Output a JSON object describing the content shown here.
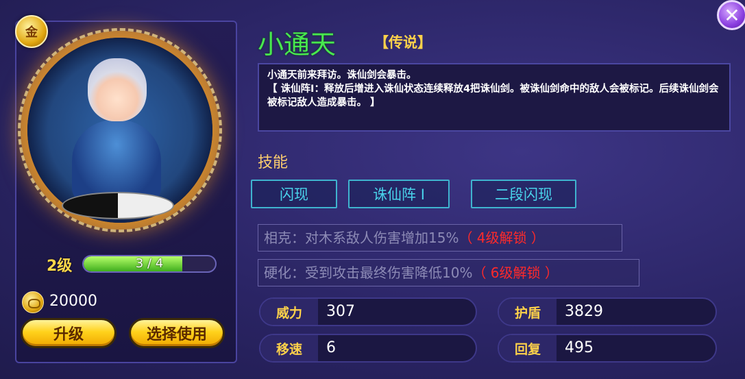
{
  "hero": {
    "name": "小通天",
    "rarity": "【传说】",
    "badge": "金",
    "level_label": "2级",
    "exp_text": "3 / 4",
    "exp_progress": 0.75,
    "upgrade_cost": "20000"
  },
  "description": {
    "line1": "小通天前来拜访。诛仙剑会暴击。",
    "line2": "【 诛仙阵Ⅰ：释放后增进入诛仙状态连续释放4把诛仙剑。被诛仙剑命中的敌人会被标记。后续诛仙剑会被标记敌人造成暴击。 】"
  },
  "skills": {
    "title": "技能",
    "items": [
      "闪现",
      "诛仙阵 I",
      "二段闪现"
    ]
  },
  "traits": [
    {
      "text": "相克：对木系敌人伤害增加15%",
      "lock": "（ 4级解锁 ）"
    },
    {
      "text": "硬化：受到攻击最终伤害降低10%",
      "lock": "（ 6级解锁 ）"
    }
  ],
  "stats": {
    "power": {
      "label": "威力",
      "value": "307"
    },
    "shield": {
      "label": "护盾",
      "value": "3829"
    },
    "speed": {
      "label": "移速",
      "value": "6"
    },
    "regen": {
      "label": "回复",
      "value": "495"
    }
  },
  "buttons": {
    "upgrade": "升级",
    "select": "选择使用",
    "close": "✕"
  },
  "colors": {
    "name": "#48e84f",
    "rarity": "#ffd24a",
    "skill": "#49d2ea",
    "locked": "#ff2a2a",
    "stat_label": "#ffd24a"
  },
  "icons": {
    "badge": "gold-rank-icon",
    "coin": "coin-icon",
    "close": "close-icon"
  }
}
